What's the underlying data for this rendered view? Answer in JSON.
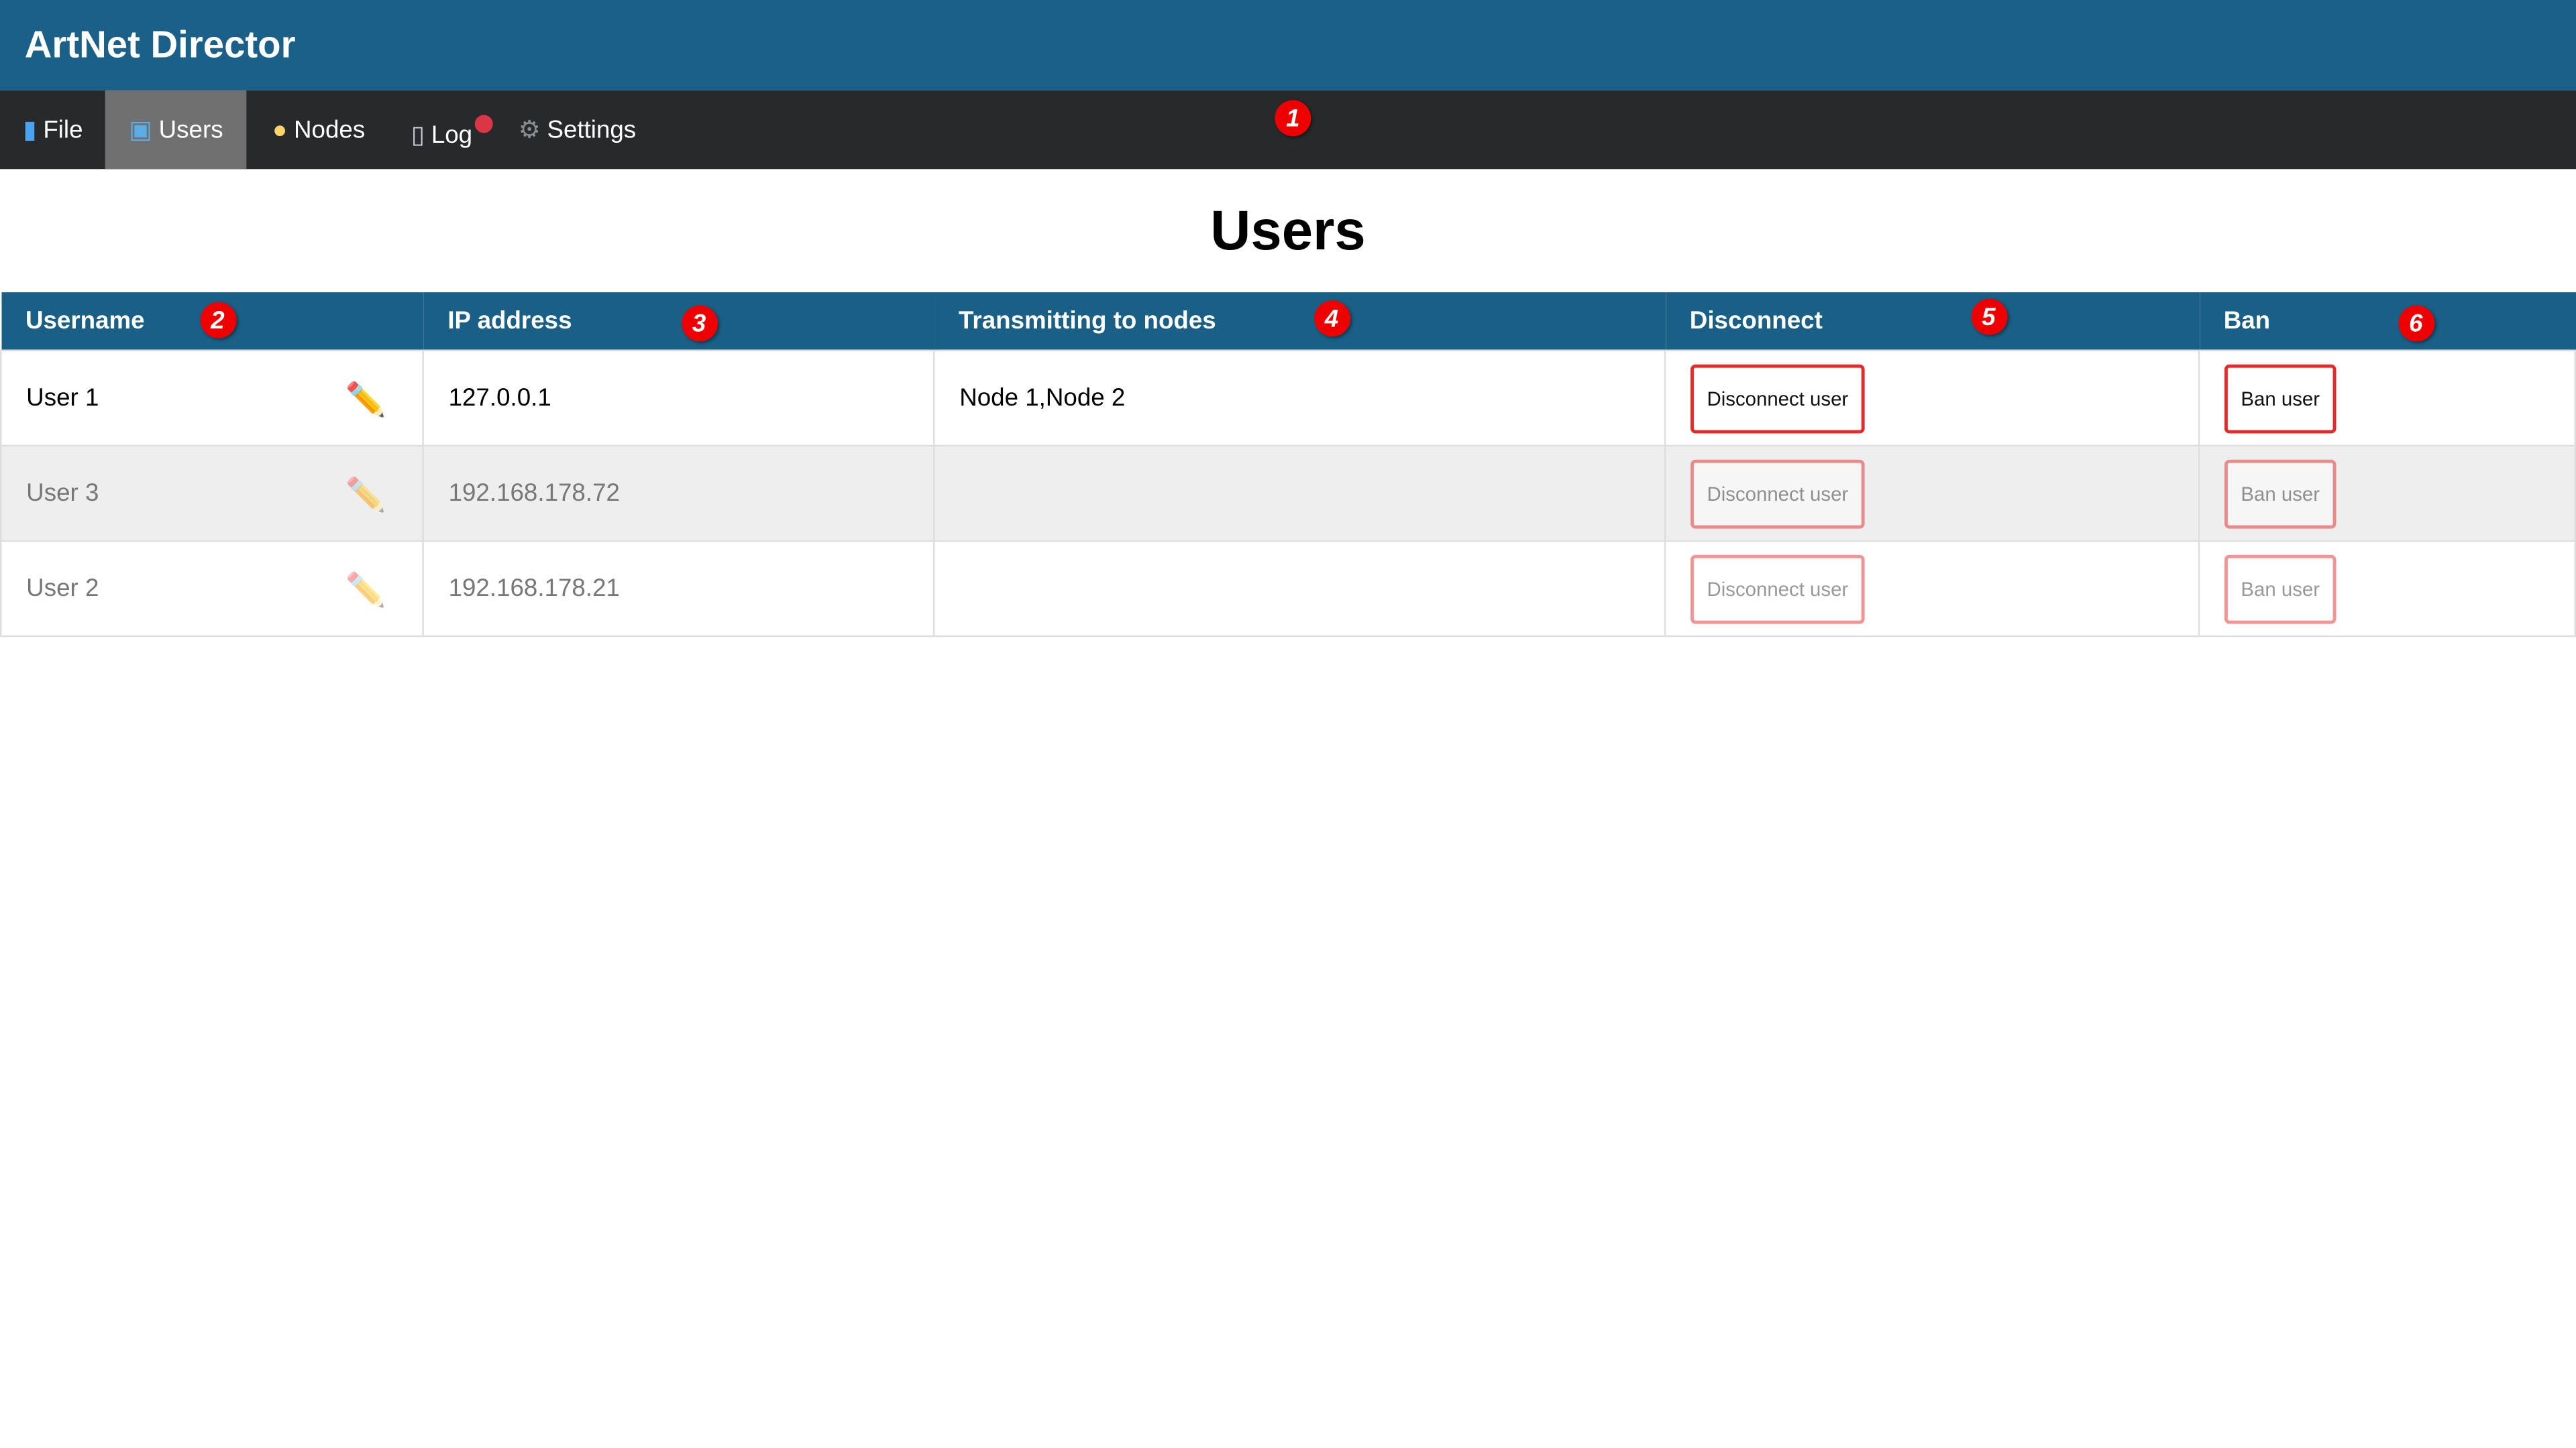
{
  "app": {
    "title": "ArtNet Director"
  },
  "nav": {
    "items": [
      {
        "label": "File",
        "icon": "folder-icon"
      },
      {
        "label": "Users",
        "icon": "laptop-icon",
        "active": true
      },
      {
        "label": "Nodes",
        "icon": "lightbulb-icon"
      },
      {
        "label": "Log",
        "icon": "scroll-icon",
        "notification": true
      },
      {
        "label": "Settings",
        "icon": "gear-icon"
      }
    ]
  },
  "page": {
    "title": "Users"
  },
  "table": {
    "headers": [
      "Username",
      "IP address",
      "Transmitting to nodes",
      "Disconnect",
      "Ban"
    ],
    "rows": [
      {
        "username": "User 1",
        "ip": "127.0.0.1",
        "nodes": "Node 1,Node 2",
        "disconnect": "Disconnect user",
        "ban": "Ban user"
      },
      {
        "username": "User 3",
        "ip": "192.168.178.72",
        "nodes": "",
        "disconnect": "Disconnect user",
        "ban": "Ban user"
      },
      {
        "username": "User 2",
        "ip": "192.168.178.21",
        "nodes": "",
        "disconnect": "Disconnect user",
        "ban": "Ban user"
      }
    ]
  },
  "annotations": [
    "1",
    "2",
    "3",
    "4",
    "5",
    "6"
  ],
  "colors": {
    "appbar": "#1a6089",
    "nav": "#27292b",
    "nav_active": "#707070",
    "table_header": "#1a5f85",
    "button_border": "#e32b2b",
    "badge": "#ee0000"
  }
}
